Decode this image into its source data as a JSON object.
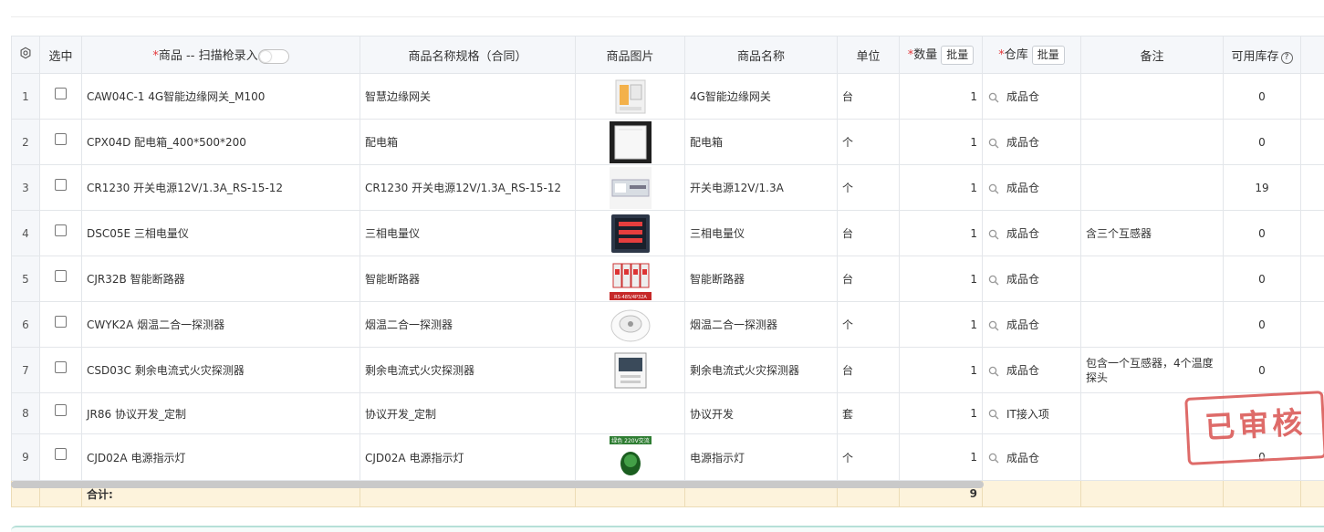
{
  "table": {
    "headers": {
      "select": "选中",
      "product_req": "*",
      "product": "商品 -- 扫描枪录入",
      "spec": "商品名称规格（合同）",
      "image": "商品图片",
      "name": "商品名称",
      "unit": "单位",
      "qty_req": "*",
      "qty": "数量",
      "batch": "批量",
      "wh_req": "*",
      "warehouse": "仓库",
      "remark": "备注",
      "stock": "可用库存"
    },
    "rows": [
      {
        "idx": "1",
        "product": "CAW04C-1 4G智能边缘网关_M100",
        "spec": "智慧边缘网关",
        "name": "4G智能边缘网关",
        "unit": "台",
        "qty": "1",
        "warehouse": "成品仓",
        "remark": "",
        "stock": "0"
      },
      {
        "idx": "2",
        "product": "CPX04D 配电箱_400*500*200",
        "spec": "配电箱",
        "name": "配电箱",
        "unit": "个",
        "qty": "1",
        "warehouse": "成品仓",
        "remark": "",
        "stock": "0"
      },
      {
        "idx": "3",
        "product": "CR1230 开关电源12V/1.3A_RS-15-12",
        "spec": "CR1230 开关电源12V/1.3A_RS-15-12",
        "name": "开关电源12V/1.3A",
        "unit": "个",
        "qty": "1",
        "warehouse": "成品仓",
        "remark": "",
        "stock": "19"
      },
      {
        "idx": "4",
        "product": "DSC05E 三相电量仪",
        "spec": "三相电量仪",
        "name": "三相电量仪",
        "unit": "台",
        "qty": "1",
        "warehouse": "成品仓",
        "remark": "含三个互感器",
        "stock": "0"
      },
      {
        "idx": "5",
        "product": "CJR32B 智能断路器",
        "spec": "智能断路器",
        "name": "智能断路器",
        "unit": "台",
        "qty": "1",
        "warehouse": "成品仓",
        "remark": "",
        "stock": "0"
      },
      {
        "idx": "6",
        "product": "CWYK2A 烟温二合一探测器",
        "spec": "烟温二合一探测器",
        "name": "烟温二合一探测器",
        "unit": "个",
        "qty": "1",
        "warehouse": "成品仓",
        "remark": "",
        "stock": "0"
      },
      {
        "idx": "7",
        "product": "CSD03C 剩余电流式火灾探测器",
        "spec": "剩余电流式火灾探测器",
        "name": "剩余电流式火灾探测器",
        "unit": "台",
        "qty": "1",
        "warehouse": "成品仓",
        "remark": "包含一个互感器，4个温度探头",
        "stock": "0"
      },
      {
        "idx": "8",
        "product": "JR86 协议开发_定制",
        "spec": "协议开发_定制",
        "name": "协议开发",
        "unit": "套",
        "qty": "1",
        "warehouse": "IT接入项",
        "remark": "",
        "stock": ""
      },
      {
        "idx": "9",
        "product": "CJD02A 电源指示灯",
        "spec": "CJD02A 电源指示灯",
        "name": "电源指示灯",
        "unit": "个",
        "qty": "1",
        "warehouse": "成品仓",
        "remark": "",
        "stock": "0"
      }
    ],
    "thumb_labels": {
      "r5": "RS-485/4P32A",
      "r9": "绿色 220V交流"
    },
    "summary": {
      "label": "合计:",
      "qty_total": "9"
    }
  },
  "stamp": {
    "text": "已审核",
    "color": "#d9524f"
  },
  "icons": {
    "settings": "gear-icon",
    "search": "search-icon",
    "help": "question-circle-icon",
    "checkbox": "checkbox-icon",
    "toggle": "scan-toggle"
  }
}
